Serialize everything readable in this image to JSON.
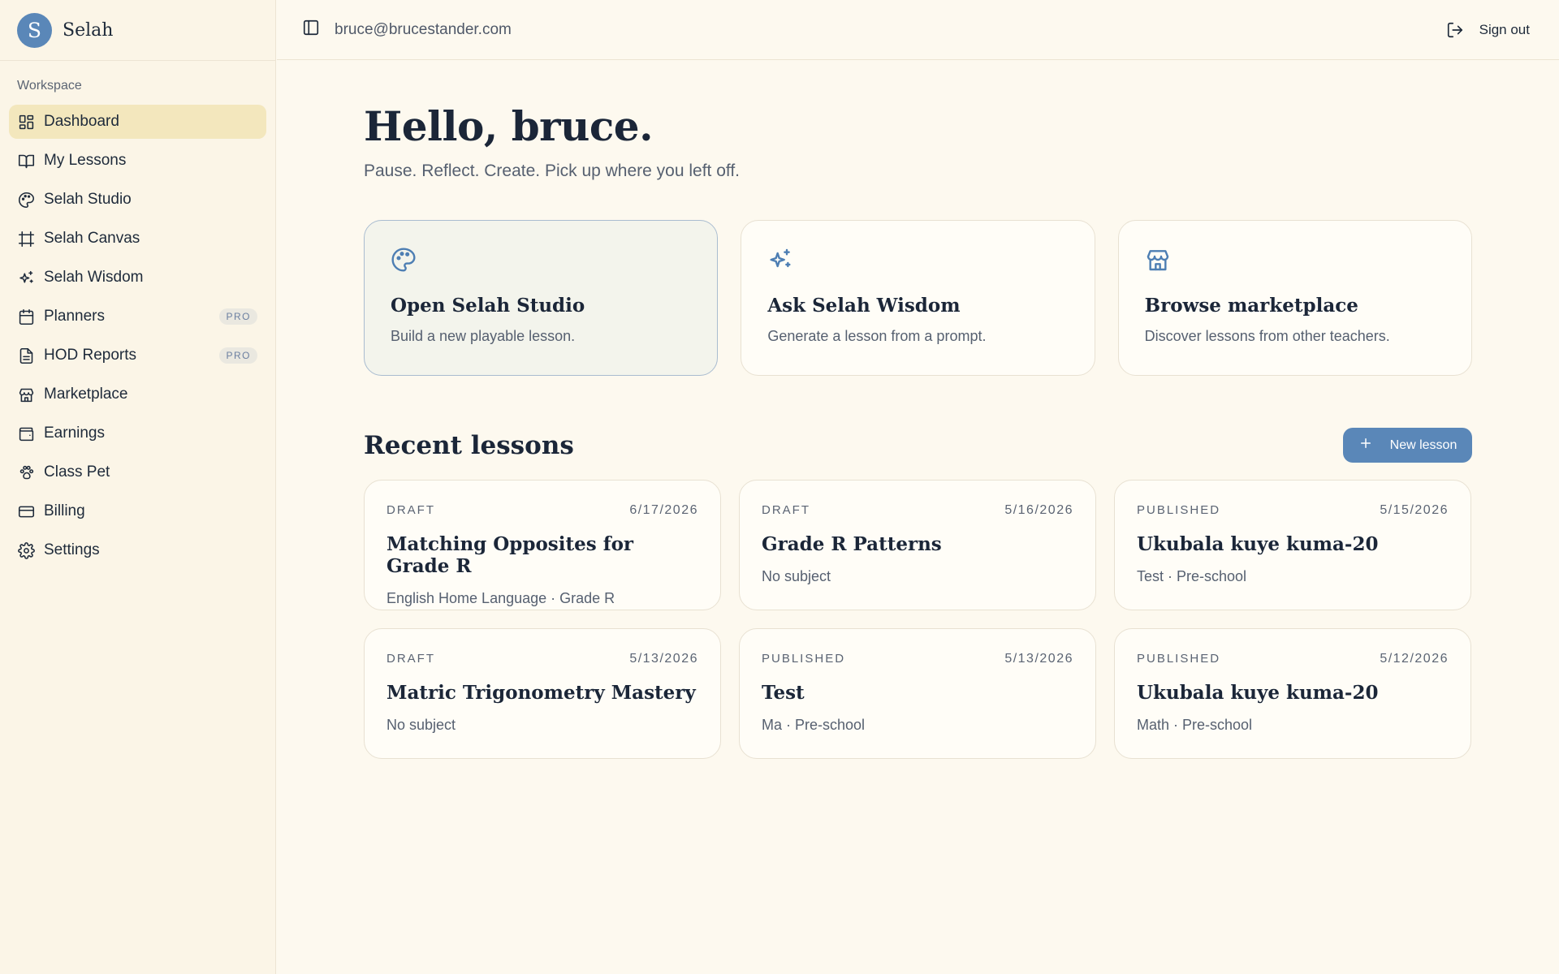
{
  "brand": {
    "logo_letter": "S",
    "name": "Selah"
  },
  "sidebar": {
    "section_label": "Workspace",
    "items": [
      {
        "label": "Dashboard",
        "icon": "dashboard-icon",
        "active": true,
        "badge": ""
      },
      {
        "label": "My Lessons",
        "icon": "book-icon",
        "active": false,
        "badge": ""
      },
      {
        "label": "Selah Studio",
        "icon": "palette-icon",
        "active": false,
        "badge": ""
      },
      {
        "label": "Selah Canvas",
        "icon": "frame-icon",
        "active": false,
        "badge": ""
      },
      {
        "label": "Selah Wisdom",
        "icon": "sparkles-icon",
        "active": false,
        "badge": ""
      },
      {
        "label": "Planners",
        "icon": "calendar-icon",
        "active": false,
        "badge": "PRO"
      },
      {
        "label": "HOD Reports",
        "icon": "file-text-icon",
        "active": false,
        "badge": "PRO"
      },
      {
        "label": "Marketplace",
        "icon": "store-icon",
        "active": false,
        "badge": ""
      },
      {
        "label": "Earnings",
        "icon": "wallet-icon",
        "active": false,
        "badge": ""
      },
      {
        "label": "Class Pet",
        "icon": "paw-icon",
        "active": false,
        "badge": ""
      },
      {
        "label": "Billing",
        "icon": "credit-card-icon",
        "active": false,
        "badge": ""
      },
      {
        "label": "Settings",
        "icon": "gear-icon",
        "active": false,
        "badge": ""
      }
    ]
  },
  "topbar": {
    "email": "bruce@brucestander.com",
    "signout_label": "Sign out"
  },
  "main": {
    "greeting": "Hello, bruce.",
    "subtitle": "Pause. Reflect. Create. Pick up where you left off.",
    "quick_actions": [
      {
        "title": "Open Selah Studio",
        "desc": "Build a new playable lesson.",
        "icon": "palette-icon"
      },
      {
        "title": "Ask Selah Wisdom",
        "desc": "Generate a lesson from a prompt.",
        "icon": "sparkles-icon"
      },
      {
        "title": "Browse marketplace",
        "desc": "Discover lessons from other teachers.",
        "icon": "store-icon"
      }
    ],
    "recent_title": "Recent lessons",
    "new_lesson_label": "New lesson",
    "lessons": [
      {
        "status": "DRAFT",
        "date": "6/17/2026",
        "title": "Matching Opposites for Grade R",
        "sub": "English Home Language · Grade R"
      },
      {
        "status": "DRAFT",
        "date": "5/16/2026",
        "title": "Grade R Patterns",
        "sub": "No subject"
      },
      {
        "status": "PUBLISHED",
        "date": "5/15/2026",
        "title": "Ukubala kuye kuma-20",
        "sub": "Test · Pre-school"
      },
      {
        "status": "DRAFT",
        "date": "5/13/2026",
        "title": "Matric Trigonometry Mastery",
        "sub": "No subject"
      },
      {
        "status": "PUBLISHED",
        "date": "5/13/2026",
        "title": "Test",
        "sub": "Ma · Pre-school"
      },
      {
        "status": "PUBLISHED",
        "date": "5/12/2026",
        "title": "Ukubala kuye kuma-20",
        "sub": "Math · Pre-school"
      }
    ]
  }
}
